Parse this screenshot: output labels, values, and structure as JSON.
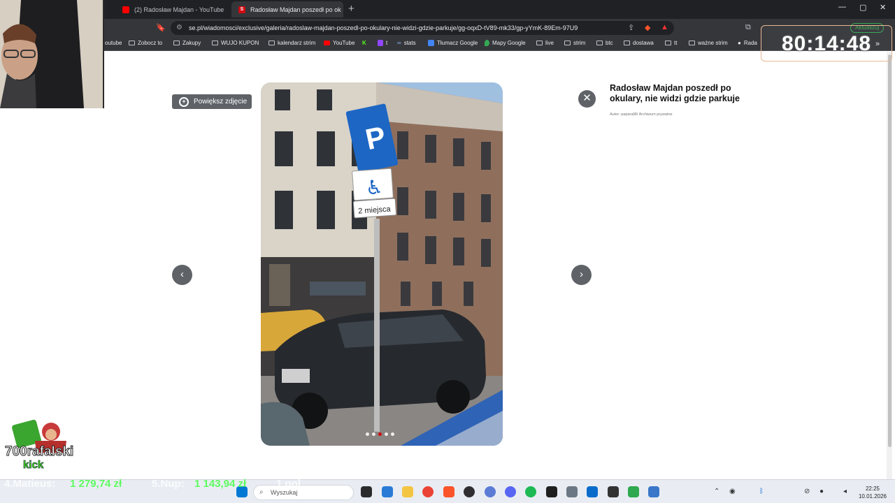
{
  "browser": {
    "tabs": [
      {
        "label": "(2) Radosław Majdan - YouTube",
        "favicon_color": "#ff0000"
      },
      {
        "label": "Radosław Majdan poszedł po ok",
        "favicon_color": "#d10a11",
        "favicon_text": "S"
      }
    ],
    "new_tab_symbol": "+",
    "window_controls": [
      "—",
      "▢",
      "✕"
    ],
    "url": "se.pl/wiadomosci/exclusive/galeria/radoslaw-majdan-poszedl-po-okulary-nie-widzi-gdzie-parkuje/gg-oqxD-tV89-mk33/gp-yYmK-89Em-97U9",
    "update_button": "Aktualizuj",
    "bookmarks": [
      {
        "label": "outube",
        "icon": "none"
      },
      {
        "label": "Zobocz to",
        "icon": "folder"
      },
      {
        "label": "Zakupy",
        "icon": "folder"
      },
      {
        "label": "WUJO KUPON",
        "icon": "folder"
      },
      {
        "label": "kalendarz strim",
        "icon": "folder"
      },
      {
        "label": "YouTube",
        "icon": "youtube"
      },
      {
        "label": "",
        "icon": "kick"
      },
      {
        "label": "t",
        "icon": "twitch"
      },
      {
        "label": "stats",
        "icon": "link"
      },
      {
        "label": "Tłumacz Google",
        "icon": "translate"
      },
      {
        "label": "Mapy Google",
        "icon": "maps"
      },
      {
        "label": "live",
        "icon": "folder"
      },
      {
        "label": "strim",
        "icon": "folder"
      },
      {
        "label": "btc",
        "icon": "folder"
      },
      {
        "label": "dostawa",
        "icon": "folder"
      },
      {
        "label": "tt",
        "icon": "folder"
      },
      {
        "label": "ważne strim",
        "icon": "folder"
      },
      {
        "label": "Rada",
        "icon": "site"
      }
    ]
  },
  "gallery": {
    "zoom_label": "Powiększ zdjęcie",
    "title": "Radosław Majdan poszedł po okulary, nie widzi gdzie parkuje",
    "author": "Autor: paparall8/ Archiwum prywatne",
    "sign_p": "P",
    "sign_text": "2 miejsca",
    "dots": 5,
    "active_dot": 2,
    "prev_icon": "‹",
    "next_icon": "›",
    "close_icon": "✕"
  },
  "overlay": {
    "timer": "80:14:48",
    "channel": "700rafalski",
    "kick_text": "kick",
    "ticker": [
      {
        "name": "4.Matieus:",
        "amount": "1 279,74 zł"
      },
      {
        "name": "5.Nup:",
        "amount": "1 143,94 zł"
      },
      {
        "name": "1 gol",
        "amount": ""
      }
    ]
  },
  "taskbar": {
    "search_placeholder": "Wyszukaj",
    "time": "22:25",
    "date": "10.01.2026",
    "icons": [
      "windows-icon",
      "search-icon",
      "task-view-icon",
      "photos-icon",
      "explorer-icon",
      "chrome-icon",
      "brave-icon",
      "obs-icon",
      "browser-icon",
      "discord-icon",
      "spotify-icon",
      "app-icon",
      "calculator-icon",
      "kick-icon",
      "app2-icon",
      "notes-icon",
      "files-icon"
    ]
  }
}
